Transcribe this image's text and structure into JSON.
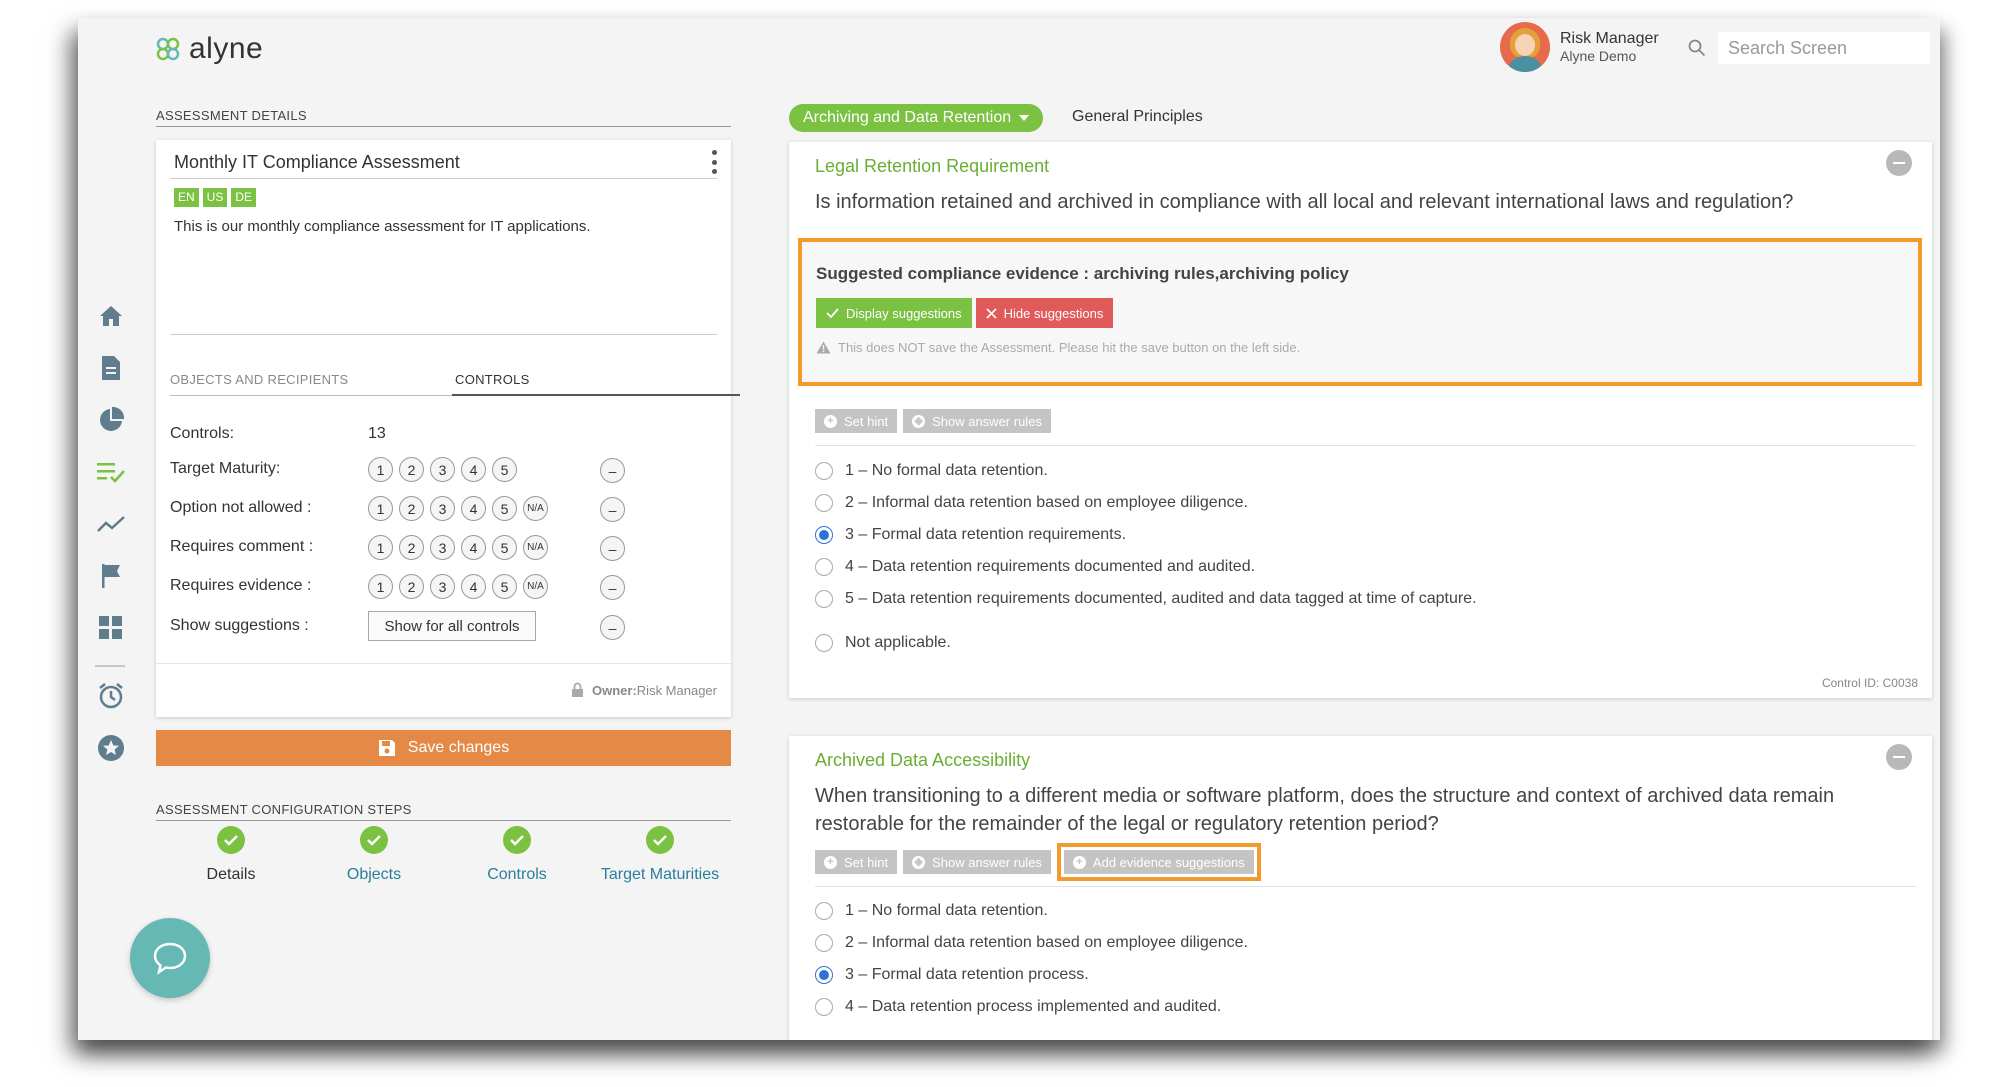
{
  "brand": {
    "name": "alyne"
  },
  "user": {
    "name": "Risk Manager",
    "org": "Alyne Demo"
  },
  "search": {
    "placeholder": "Search Screen"
  },
  "sidebar": {
    "icons": [
      "home-icon",
      "document-icon",
      "pie-chart-icon",
      "checklist-icon",
      "trend-icon",
      "flag-icon",
      "dashboard-icon",
      "alarm-clock-icon",
      "star-icon"
    ]
  },
  "assessment_details": {
    "section_label": "ASSESSMENT DETAILS",
    "title": "Monthly IT Compliance Assessment",
    "languages": [
      "EN",
      "US",
      "DE"
    ],
    "description": "This is our monthly compliance assessment for IT applications.",
    "tabs": {
      "objects": "OBJECTS AND RECIPIENTS",
      "controls": "CONTROLS"
    },
    "controls_label": "Controls:",
    "controls_count": "13",
    "rows": {
      "target_maturity": "Target Maturity:",
      "option_not_allowed": "Option not allowed :",
      "requires_comment": "Requires comment :",
      "requires_evidence": "Requires evidence :",
      "show_suggestions": "Show suggestions :"
    },
    "levels": [
      "1",
      "2",
      "3",
      "4",
      "5"
    ],
    "na_label": "N/A",
    "minus_label": "–",
    "show_all_button": "Show for all controls",
    "owner_label": "Owner:",
    "owner_value": "Risk Manager"
  },
  "save_button": "Save changes",
  "config_steps": {
    "section_label": "ASSESSMENT CONFIGURATION STEPS",
    "steps": [
      "Details",
      "Objects",
      "Controls",
      "Target Maturities"
    ]
  },
  "topic": {
    "selected": "Archiving and Data Retention",
    "other": "General Principles"
  },
  "controls": [
    {
      "title": "Legal Retention Requirement",
      "question": "Is information retained and archived in compliance with all local and relevant international laws and regulation?",
      "evidence_title": "Suggested compliance evidence : archiving rules,archiving policy",
      "display_btn": "Display suggestions",
      "hide_btn": "Hide suggestions",
      "warning": "This does NOT save the Assessment. Please hit the save button on the left side.",
      "set_hint": "Set hint",
      "answer_rules": "Show answer rules",
      "options": [
        "1 –  No formal data retention.",
        "2 –  Informal data retention based on employee diligence.",
        "3 –  Formal data retention requirements.",
        "4 –  Data retention requirements documented and audited.",
        "5 –  Data retention requirements documented, audited and data tagged at time of capture.",
        "Not applicable."
      ],
      "selected_index": 2,
      "control_id": "Control ID: C0038"
    },
    {
      "title": "Archived Data Accessibility",
      "question": "When transitioning to a different media or software platform, does the structure and context of archived data remain restorable for the remainder of the legal or regulatory retention period?",
      "set_hint": "Set hint",
      "answer_rules": "Show answer rules",
      "add_evidence": "Add evidence suggestions",
      "options": [
        "1 –  No formal data retention.",
        "2 –  Informal data retention based on employee diligence.",
        "3 –  Formal data retention process.",
        "4 –  Data retention process implemented and audited."
      ],
      "selected_index": 2
    }
  ],
  "colors": {
    "accent_green": "#7bc142",
    "save_orange": "#e58a46",
    "highlight_orange": "#f09a2f",
    "hide_red": "#e05a5a",
    "radio_blue": "#2f72d6"
  }
}
